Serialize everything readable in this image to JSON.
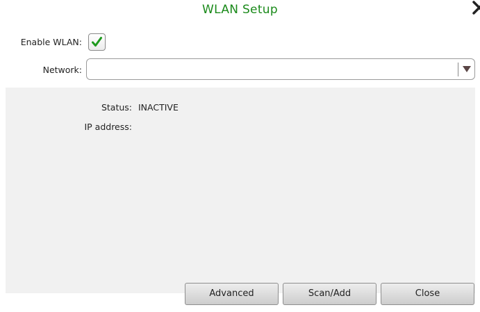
{
  "dialog": {
    "title": "WLAN Setup"
  },
  "form": {
    "enable_label": "Enable WLAN:",
    "enable_checked": true,
    "network_label": "Network:",
    "network_value": ""
  },
  "status": {
    "status_label": "Status:",
    "status_value": "INACTIVE",
    "ip_label": "IP address:",
    "ip_value": ""
  },
  "buttons": {
    "advanced": "Advanced",
    "scan_add": "Scan/Add",
    "close": "Close"
  },
  "colors": {
    "title": "#1a8a1a",
    "checkmark": "#1e9a1e",
    "panel": "#f1f1f1"
  },
  "icons": {
    "close": "close-icon",
    "checkmark": "checkmark-icon",
    "dropdown": "dropdown-arrow-icon"
  }
}
